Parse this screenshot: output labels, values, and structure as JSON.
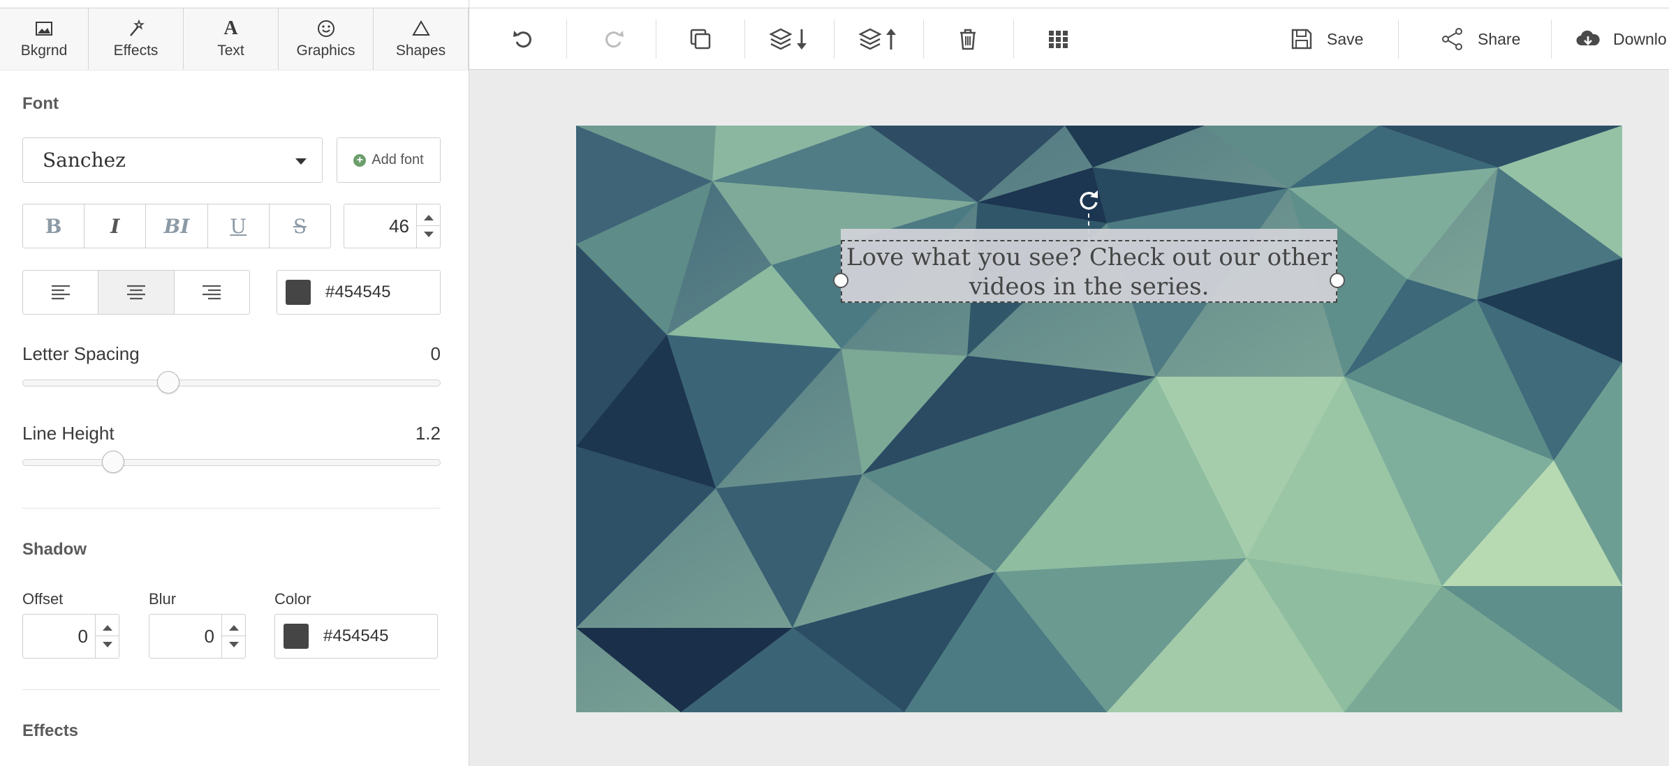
{
  "tabs": [
    {
      "label": "Bkgrnd",
      "icon": "image-icon"
    },
    {
      "label": "Effects",
      "icon": "magic-wand-icon"
    },
    {
      "label": "Text",
      "icon": "text-a-icon"
    },
    {
      "label": "Graphics",
      "icon": "smiley-icon"
    },
    {
      "label": "Shapes",
      "icon": "triangle-icon"
    }
  ],
  "toolbar": {
    "tools": [
      "undo-icon",
      "redo-icon",
      "duplicate-icon",
      "send-backward-icon",
      "bring-forward-icon",
      "delete-icon",
      "grid-icon"
    ],
    "save_label": "Save",
    "share_label": "Share",
    "download_label": "Downlo"
  },
  "panel": {
    "font_title": "Font",
    "font_name": "Sanchez",
    "add_font_label": "Add font",
    "style_buttons": [
      "B",
      "I",
      "BI",
      "U",
      "S"
    ],
    "font_size": "46",
    "alignment": {
      "options": [
        "left",
        "center",
        "right"
      ],
      "selected": "center"
    },
    "text_color": {
      "hex": "#454545",
      "swatch": "#454545"
    },
    "letter_spacing": {
      "label": "Letter Spacing",
      "value": "0",
      "position": 0.34
    },
    "line_height": {
      "label": "Line Height",
      "value": "1.2",
      "position": 0.2
    },
    "shadow_title": "Shadow",
    "shadow": {
      "offset_label": "Offset",
      "offset_value": "0",
      "blur_label": "Blur",
      "blur_value": "0",
      "color_label": "Color",
      "color_hex": "#454545"
    },
    "effects_title": "Effects"
  },
  "canvas": {
    "text": "Love what you see? Check out our other videos in the series.",
    "text_color": "#454545",
    "selection_bg": "#d0d2d7",
    "background_palette": [
      "#1e3a52",
      "#3e6679",
      "#6d9a8f",
      "#a8ceaa",
      "#eef7dc"
    ]
  }
}
